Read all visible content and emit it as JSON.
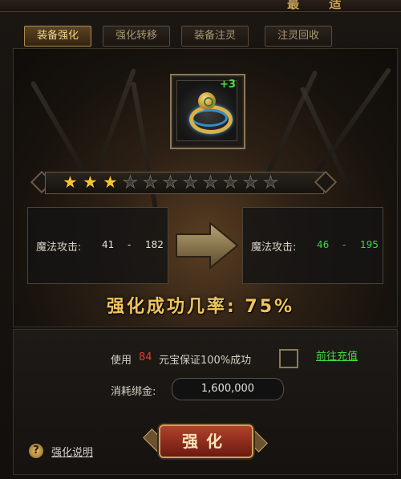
{
  "window": {
    "title": "最 适"
  },
  "tabs": [
    {
      "label": "装备强化",
      "active": true
    },
    {
      "label": "强化转移",
      "active": false
    },
    {
      "label": "装备注灵",
      "active": false
    },
    {
      "label": "注灵回收",
      "active": false
    }
  ],
  "item": {
    "level_badge": "+3",
    "icon": "ring-icon"
  },
  "stars": {
    "filled": 3,
    "total": 11,
    "filled_glyph": "★",
    "empty_glyph": "★"
  },
  "stats": {
    "current": {
      "label": "魔法攻击:",
      "min": "41",
      "dash": "-",
      "max": "182"
    },
    "next": {
      "label": "魔法攻击:",
      "min": "46",
      "dash": "-",
      "max": "195"
    }
  },
  "success_rate": "强化成功几率: 75%",
  "guarantee": {
    "prefix": "使用",
    "amount": "84",
    "suffix": "元宝保证100%成功",
    "checked": false
  },
  "recharge_link": "前往充值",
  "gold_cost": {
    "label": "消耗绑金:",
    "value": "1,600,000"
  },
  "enhance_button": "强化",
  "help": {
    "icon": "?",
    "label": "强化说明"
  },
  "colors": {
    "accent": "#f0c560",
    "green": "#3fd83f",
    "red": "#e23b2c"
  }
}
